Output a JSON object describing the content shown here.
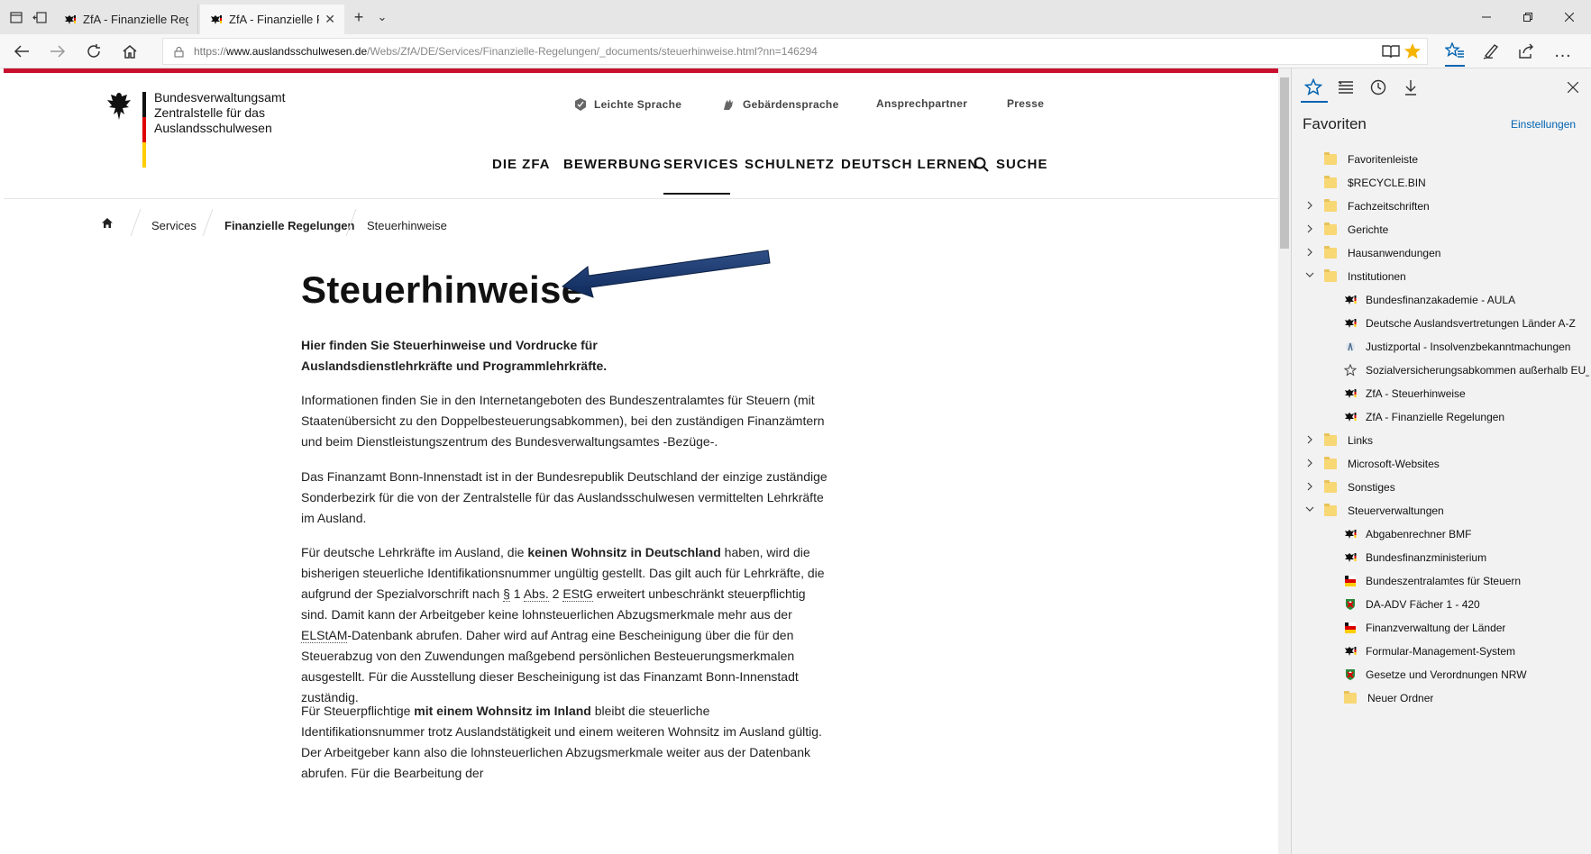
{
  "browser": {
    "tabs": [
      {
        "label": "ZfA - Finanzielle Regelunge",
        "active": false
      },
      {
        "label": "ZfA - Finanzielle Regelu",
        "active": true
      }
    ],
    "new_tab": "+",
    "tab_menu": "⌄",
    "url_scheme": "https://",
    "url_host": "www.auslandsschulwesen.de",
    "url_path": "/Webs/ZfA/DE/Services/Finanzielle-Regelungen/_documents/steuerhinweise.html?nn=146294",
    "icons": {
      "back": "back-arrow-icon",
      "forward": "forward-arrow-icon",
      "refresh": "refresh-icon",
      "home": "home-icon",
      "reading": "reading-view-icon",
      "favorite": "star-icon"
    },
    "accent": "#0063b1"
  },
  "site": {
    "logo_lines": [
      "Bundesverwaltungsamt",
      "Zentralstelle für das",
      "Auslandsschulwesen"
    ],
    "meta_nav": [
      "Leichte Sprache",
      "Gebärdensprache",
      "Ansprechpartner",
      "Presse"
    ],
    "main_nav": [
      "DIE ZFA",
      "BEWERBUNG",
      "SERVICES",
      "SCHULNETZ",
      "DEUTSCH LERNEN",
      "SUCHE"
    ],
    "active_nav": "SERVICES",
    "breadcrumb": [
      "Services",
      "Finanzielle Regelungen",
      "Steuerhinweise"
    ],
    "brand_red": "#c8102e"
  },
  "article": {
    "title": "Steuerhinweise",
    "intro": "Hier finden Sie Steuerhinweise und Vordrucke für Auslandsdienstlehrkräfte und Programmlehrkräfte.",
    "p1": "Informationen finden Sie in den Internetangeboten des Bundeszentralamtes für Steuern (mit Staatenübersicht zu den Doppelbesteuerungsabkommen), bei den zuständigen Finanzämtern und beim Dienstleistungszentrum des Bundesverwaltungsamtes -Bezüge-.",
    "p2": "Das Finanzamt Bonn-Innenstadt ist in der Bundesrepublik Deutschland der einzige zuständige Sonderbezirk für die von der Zentralstelle für das Auslandsschulwesen vermittelten Lehrkräfte im Ausland.",
    "p3": {
      "a": "Für deutsche Lehrkräfte im Ausland, die ",
      "b": "keinen Wohnsitz in Deutschland",
      "c": " haben, wird die bisherigen steuerliche Identifikationsnummer ungültig gestellt. Das gilt auch für Lehrkräfte, die aufgrund der Spezialvorschrift nach ",
      "d": "§",
      "e": " 1 ",
      "f": "Abs.",
      "g": " 2 ",
      "h": "EStG",
      "i": " erweitert unbeschränkt steuerpflichtig sind. Damit kann der Arbeitgeber keine lohnsteuerlichen Abzugsmerkmale mehr aus der ",
      "j": "ELStAM",
      "k": "-Datenbank abrufen. Daher wird auf Antrag eine Bescheinigung über die für den Steuerabzug von den Zuwendungen maßgebend persönlichen Besteuerungsmerkmalen ausgestellt. Für die Ausstellung dieser Bescheinigung ist das Finanzamt Bonn-Innenstadt zuständig."
    },
    "p4": {
      "a": "Für Steuerpflichtige ",
      "b": "mit einem Wohnsitz im Inland",
      "c": " bleibt die steuerliche Identifikationsnummer trotz Auslandstätigkeit und einem weiteren Wohnsitz im Ausland gültig. Der Arbeitgeber kann also die lohnsteuerlichen Abzugsmerkmale weiter aus der Datenbank abrufen. Für die Bearbeitung der"
    }
  },
  "favorites": {
    "title": "Favoriten",
    "settings": "Einstellungen",
    "items": [
      {
        "label": "Favoritenleiste",
        "type": "folder",
        "level": 0,
        "chevron": ""
      },
      {
        "label": "$RECYCLE.BIN",
        "type": "folder",
        "level": 0,
        "chevron": ""
      },
      {
        "label": "Fachzeitschriften",
        "type": "folder",
        "level": 0,
        "chevron": "›"
      },
      {
        "label": "Gerichte",
        "type": "folder",
        "level": 0,
        "chevron": "›"
      },
      {
        "label": "Hausanwendungen",
        "type": "folder",
        "level": 0,
        "chevron": "›"
      },
      {
        "label": "Institutionen",
        "type": "folder",
        "level": 0,
        "chevron": "⌄"
      },
      {
        "label": "Bundesfinanzakademie - AULA",
        "type": "eagle",
        "level": 1
      },
      {
        "label": "Deutsche Auslandsvertretungen Länder A-Z",
        "type": "eagle",
        "level": 1
      },
      {
        "label": "Justizportal - Insolvenzbekanntmachungen",
        "type": "justice",
        "level": 1
      },
      {
        "label": "Sozialversicherungsabkommen außerhalb EU_E",
        "type": "star",
        "level": 1
      },
      {
        "label": "ZfA - Steuerhinweise",
        "type": "eagle",
        "level": 1
      },
      {
        "label": "ZfA - Finanzielle Regelungen",
        "type": "eagle",
        "level": 1
      },
      {
        "label": "Links",
        "type": "folder",
        "level": 0,
        "chevron": "›"
      },
      {
        "label": "Microsoft-Websites",
        "type": "folder",
        "level": 0,
        "chevron": "›"
      },
      {
        "label": "Sonstiges",
        "type": "folder",
        "level": 0,
        "chevron": "›"
      },
      {
        "label": "Steuerverwaltungen",
        "type": "folder",
        "level": 0,
        "chevron": "⌄"
      },
      {
        "label": "Abgabenrechner BMF",
        "type": "eagle",
        "level": 1
      },
      {
        "label": "Bundesfinanzministerium",
        "type": "eagle",
        "level": 1
      },
      {
        "label": "Bundeszentralamtes für Steuern",
        "type": "bzst",
        "level": 1
      },
      {
        "label": "DA-ADV Fächer 1 - 420",
        "type": "nrw",
        "level": 1
      },
      {
        "label": "Finanzverwaltung der Länder",
        "type": "bzst",
        "level": 1
      },
      {
        "label": "Formular-Management-System",
        "type": "eagle",
        "level": 1
      },
      {
        "label": "Gesetze und Verordnungen NRW",
        "type": "nrw",
        "level": 1
      },
      {
        "label": "Neuer Ordner",
        "type": "folder",
        "level": 1
      }
    ]
  }
}
